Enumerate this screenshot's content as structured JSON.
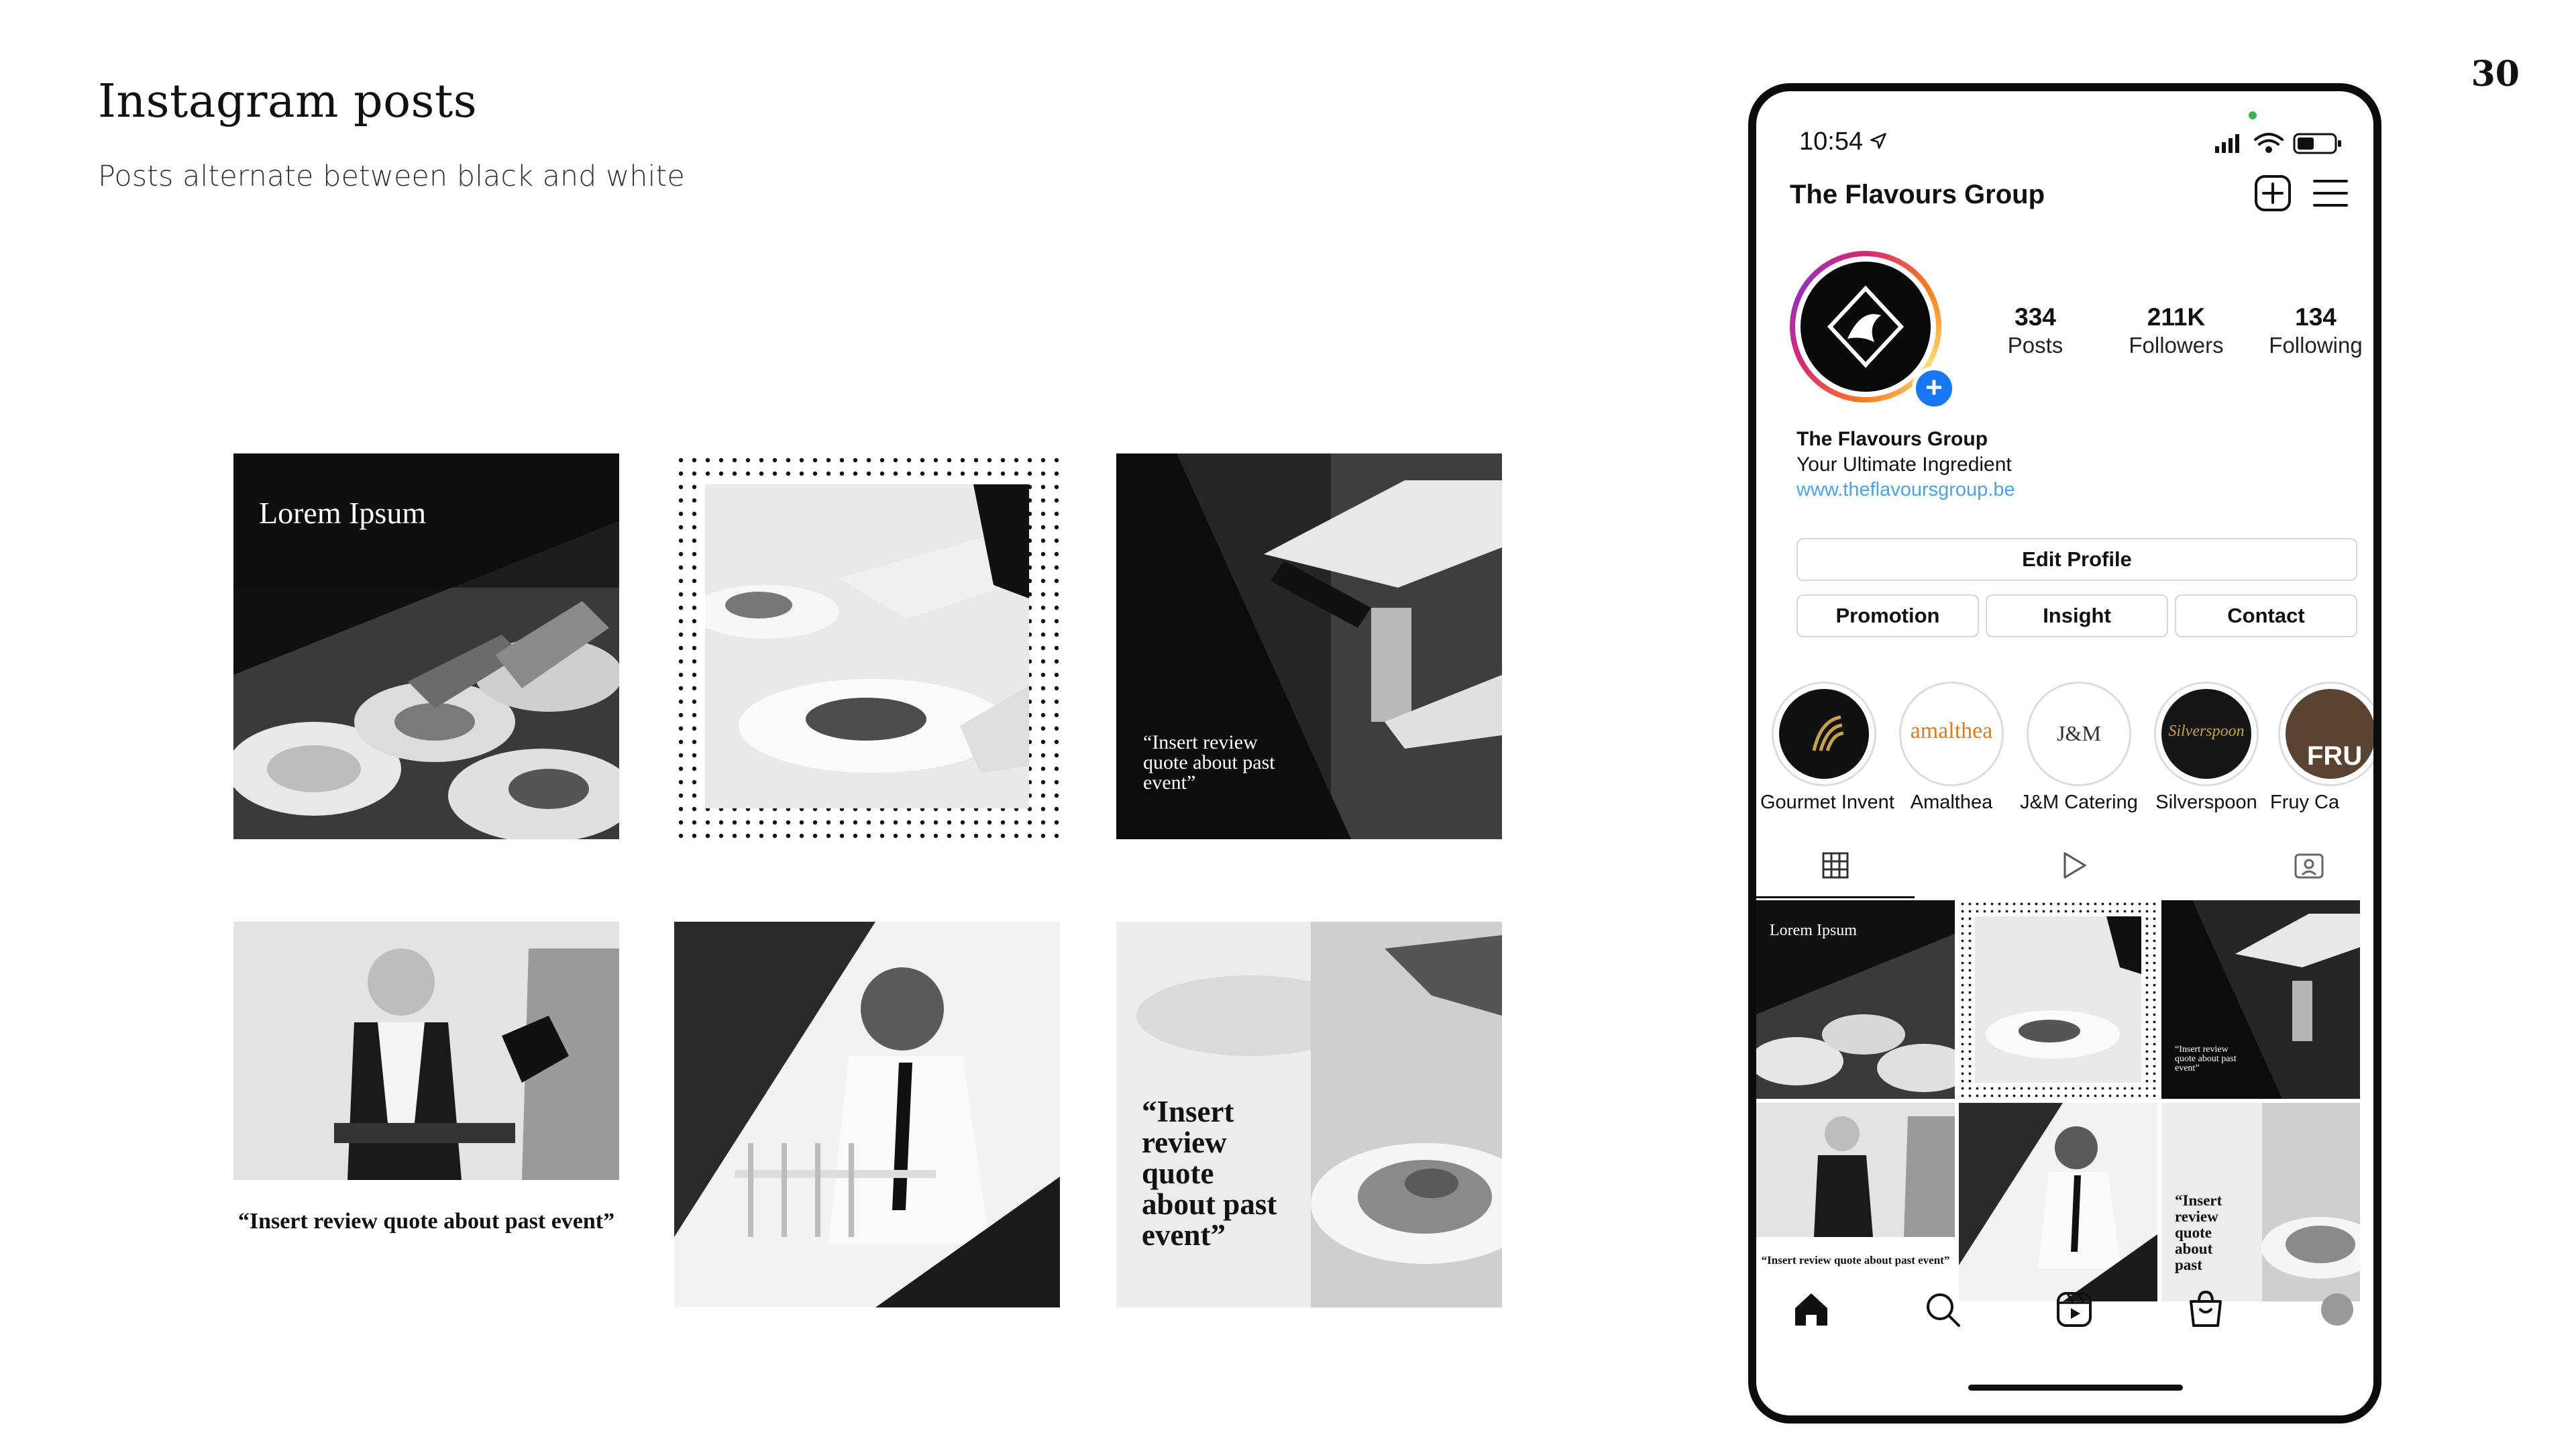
{
  "slide": {
    "title": "Instagram posts",
    "subtitle": "Posts alternate between black and white",
    "page_number": "30"
  },
  "posts": [
    {
      "heading": "Lorem Ipsum"
    },
    {
      "style": "dotted-frame"
    },
    {
      "quote": "“Insert review quote about past event”"
    },
    {
      "quote": "“Insert review quote about past event”"
    },
    {
      "style": "diagonal-split"
    },
    {
      "quote": "“Insert review quote about past event”"
    }
  ],
  "phone": {
    "status_time": "10:54",
    "account_name": "The Flavours Group",
    "stats": [
      {
        "value": "334",
        "label": "Posts"
      },
      {
        "value": "211K",
        "label": "Followers"
      },
      {
        "value": "134",
        "label": "Following"
      }
    ],
    "bio": {
      "name": "The Flavours Group",
      "tagline": "Your Ultimate Ingredient",
      "link": "www.theflavoursgroup.be"
    },
    "buttons": {
      "edit_profile": "Edit Profile",
      "promotion": "Promotion",
      "insight": "Insight",
      "contact": "Contact"
    },
    "highlights": [
      {
        "label": "Gourmet Invent",
        "logo_text": ""
      },
      {
        "label": "Amalthea",
        "logo_text": "amalthea"
      },
      {
        "label": "J&M Catering",
        "logo_text": "J&M"
      },
      {
        "label": "Silverspoon",
        "logo_text": "Silverspoon"
      },
      {
        "label": "Fruy Ca",
        "logo_text": "FRU"
      }
    ],
    "grid_posts": {
      "heading": "Lorem Ipsum",
      "quote_small": "“Insert review quote about past event”",
      "quote_below": "“Insert review quote about past event”",
      "quote_big": "“Insert review quote about past"
    },
    "icons": {
      "status": [
        "location-arrow-icon",
        "signal-icon",
        "wifi-icon",
        "battery-icon"
      ],
      "header": [
        "new-post-icon",
        "menu-icon"
      ],
      "tabs": [
        "grid-icon",
        "reels-tab-icon",
        "tagged-icon"
      ],
      "nav": [
        "home-icon",
        "search-icon",
        "reels-icon",
        "shop-icon",
        "profile-icon"
      ]
    }
  },
  "colors": {
    "instagram_link": "#4aa3e6",
    "add_badge": "#1877f2",
    "story_ring_start": "#d62976",
    "story_ring_end": "#fa7e1e"
  }
}
